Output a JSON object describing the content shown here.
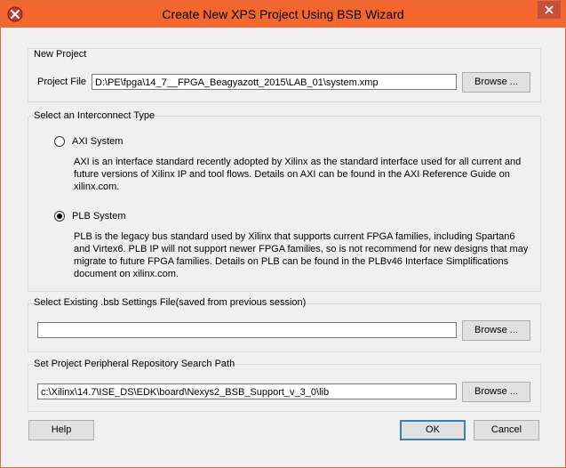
{
  "window": {
    "title": "Create New XPS Project Using BSB Wizard",
    "icon": "xilinx-logo-icon",
    "accent": "#f3672f"
  },
  "new_project": {
    "group_title": "New Project",
    "project_file_label": "Project File",
    "project_file_value": "D:\\PE\\fpga\\14_7__FPGA_Beagyazott_2015\\LAB_01\\system.xmp",
    "browse_label": "Browse ..."
  },
  "interconnect": {
    "group_title": "Select an Interconnect Type",
    "options": [
      {
        "label": "AXI System",
        "selected": false,
        "description": "AXI is an interface standard recently adopted by Xilinx as the standard interface used for all current and future versions of Xilinx IP and tool flows.  Details on AXI can be found in the AXI Reference Guide on xilinx.com."
      },
      {
        "label": "PLB System",
        "selected": true,
        "description": "PLB is the legacy bus standard used by Xilinx that supports current FPGA families, including Spartan6 and Virtex6.  PLB IP will not support newer FPGA families, so is not recommend for new designs that may migrate to future FPGA families.  Details on PLB can be found in the PLBv46 Interface Simplifications document on xilinx.com."
      }
    ]
  },
  "bsb_settings": {
    "group_title": "Select Existing .bsb Settings File(saved from previous session)",
    "value": "",
    "browse_label": "Browse ..."
  },
  "repo_path": {
    "group_title": "Set Project Peripheral Repository Search Path",
    "value": "c:\\Xilinx\\14.7\\ISE_DS\\EDK\\board\\Nexys2_BSB_Support_v_3_0\\lib",
    "browse_label": "Browse ..."
  },
  "footer": {
    "help_label": "Help",
    "ok_label": "OK",
    "cancel_label": "Cancel"
  }
}
